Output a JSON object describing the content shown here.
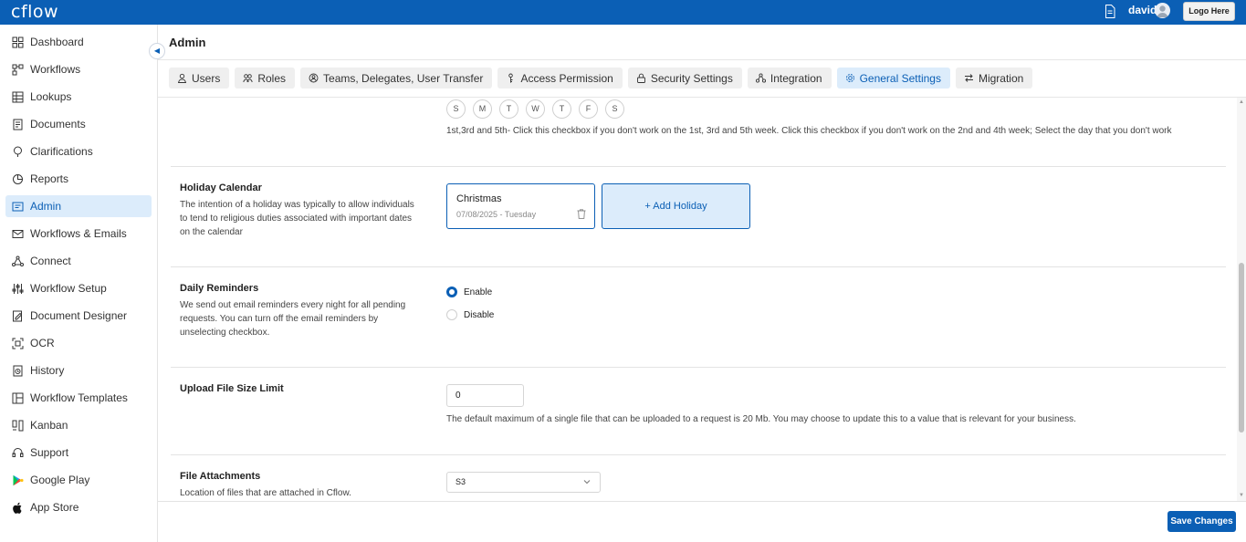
{
  "topbar": {
    "logo": "cflow",
    "user_name": "david",
    "logo_button": "Logo Here"
  },
  "sidebar": {
    "items": [
      {
        "label": "Dashboard",
        "icon": "dashboard-icon"
      },
      {
        "label": "Workflows",
        "icon": "workflows-icon"
      },
      {
        "label": "Lookups",
        "icon": "lookups-icon"
      },
      {
        "label": "Documents",
        "icon": "documents-icon"
      },
      {
        "label": "Clarifications",
        "icon": "clarifications-icon"
      },
      {
        "label": "Reports",
        "icon": "reports-icon"
      },
      {
        "label": "Admin",
        "icon": "admin-icon",
        "active": true
      },
      {
        "label": "Workflows & Emails",
        "icon": "mail-icon"
      },
      {
        "label": "Connect",
        "icon": "connect-icon"
      },
      {
        "label": "Workflow Setup",
        "icon": "sliders-icon"
      },
      {
        "label": "Document Designer",
        "icon": "document-designer-icon"
      },
      {
        "label": "OCR",
        "icon": "ocr-icon"
      },
      {
        "label": "History",
        "icon": "history-icon"
      },
      {
        "label": "Workflow Templates",
        "icon": "templates-icon"
      },
      {
        "label": "Kanban",
        "icon": "kanban-icon"
      },
      {
        "label": "Support",
        "icon": "support-icon"
      },
      {
        "label": "Google Play",
        "icon": "google-play-icon"
      },
      {
        "label": "App Store",
        "icon": "apple-icon"
      }
    ]
  },
  "header": {
    "title": "Admin"
  },
  "tabs": [
    {
      "label": "Users",
      "icon": "user-icon"
    },
    {
      "label": "Roles",
      "icon": "roles-icon"
    },
    {
      "label": "Teams, Delegates, User Transfer",
      "icon": "teams-icon"
    },
    {
      "label": "Access Permission",
      "icon": "key-icon"
    },
    {
      "label": "Security Settings",
      "icon": "lock-icon"
    },
    {
      "label": "Integration",
      "icon": "integration-icon"
    },
    {
      "label": "General Settings",
      "icon": "gear-icon",
      "active": true
    },
    {
      "label": "Migration",
      "icon": "migration-icon"
    }
  ],
  "working_days": {
    "days": [
      "S",
      "M",
      "T",
      "W",
      "T",
      "F",
      "S"
    ],
    "note": "1st,3rd and 5th- Click this checkbox if you don't work on the 1st, 3rd and 5th week. Click this checkbox if you don't work on the 2nd and 4th week; Select the day that you don't work"
  },
  "holiday_calendar": {
    "title": "Holiday Calendar",
    "description": "The intention of a holiday was typically to allow individuals to tend to religious duties associated with important dates on the calendar",
    "holidays": [
      {
        "name": "Christmas",
        "date": "07/08/2025 - Tuesday"
      }
    ],
    "add_label": "+ Add Holiday"
  },
  "daily_reminders": {
    "title": "Daily Reminders",
    "description": "We send out email reminders every night for all pending requests. You can turn off the email reminders by unselecting checkbox.",
    "options": [
      {
        "label": "Enable",
        "checked": true
      },
      {
        "label": "Disable",
        "checked": false
      }
    ]
  },
  "upload_limit": {
    "title": "Upload File Size Limit",
    "value": "0",
    "note": "The default maximum of a single file that can be uploaded to a request is 20 Mb. You may choose to update this to a value that is relevant for your business."
  },
  "file_attachments": {
    "title": "File Attachments",
    "description": "Location of files that are attached in Cflow.",
    "selected": "S3"
  },
  "footer": {
    "save_label": "Save Changes"
  },
  "colors": {
    "brand": "#0b5fb5",
    "active_bg": "#dcecfb"
  }
}
